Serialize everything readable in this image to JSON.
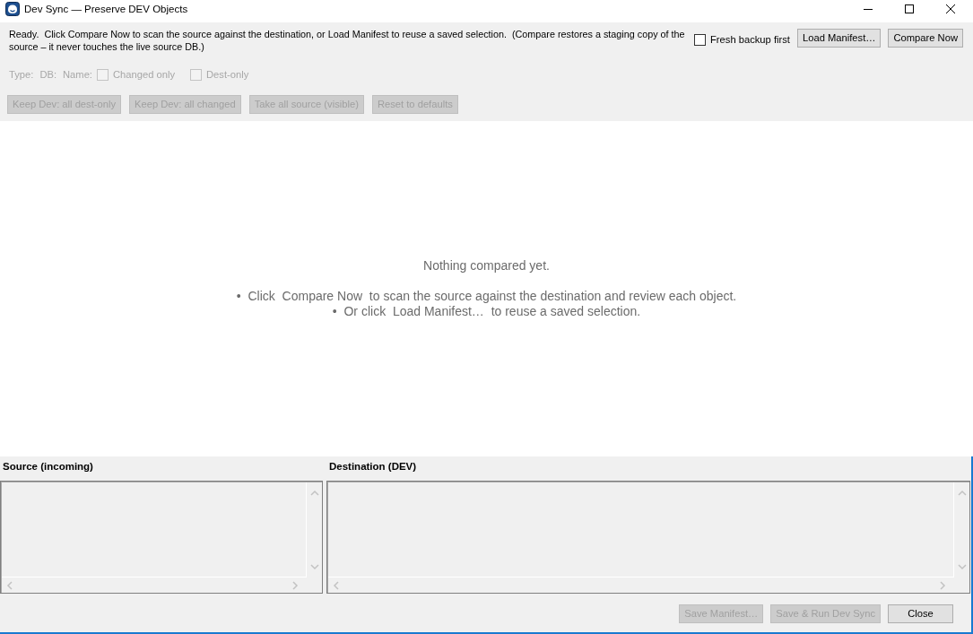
{
  "window": {
    "title": "Dev Sync — Preserve DEV Objects"
  },
  "status_message": "Ready.  Click Compare Now to scan the source against the destination, or Load Manifest to reuse a saved selection.  (Compare restores a staging copy of the source – it never touches the live source DB.)",
  "backup_option": {
    "label": "Fresh backup first",
    "checked": false
  },
  "header_buttons": [
    {
      "label": "Load Manifest…",
      "disabled": false
    },
    {
      "label": "Compare Now",
      "disabled": false
    }
  ],
  "filters": {
    "labels": [
      {
        "text": "Type:",
        "disabled": true
      },
      {
        "text": "DB:",
        "disabled": true
      },
      {
        "text": "Name:",
        "disabled": true
      }
    ],
    "checkboxes": [
      {
        "label": "Changed only",
        "checked": false,
        "disabled": true
      },
      {
        "label": "Dest-only",
        "checked": false,
        "disabled": true
      }
    ]
  },
  "action_buttons": [
    {
      "label": "Keep Dev: all dest-only",
      "disabled": true
    },
    {
      "label": "Keep Dev: all changed",
      "disabled": true
    },
    {
      "label": "Take all source (visible)",
      "disabled": true
    },
    {
      "label": "Reset to defaults",
      "disabled": true
    }
  ],
  "empty_state": {
    "title": "Nothing compared yet.",
    "hints": [
      "•  Click  Compare Now  to scan the source against the destination and review each object.",
      "•  Or click  Load Manifest…  to reuse a saved selection."
    ]
  },
  "panes": [
    {
      "title": "Source (incoming)"
    },
    {
      "title": "Destination (DEV)"
    }
  ],
  "footer_buttons": [
    {
      "label": "Save Manifest…",
      "disabled": true
    },
    {
      "label": "Save & Run Dev Sync",
      "disabled": true
    },
    {
      "label": "Close",
      "disabled": false
    }
  ]
}
